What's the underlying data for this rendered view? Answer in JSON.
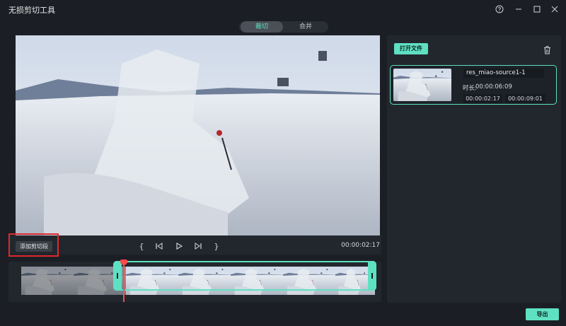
{
  "window": {
    "title": "无损剪切工具"
  },
  "tabs": [
    {
      "label": "裁切",
      "active": true
    },
    {
      "label": "合并",
      "active": false
    }
  ],
  "player": {
    "add_clip_label": "添加剪切段",
    "mark_in_symbol": "{",
    "mark_out_symbol": "}",
    "current_time": "00:00:02:17"
  },
  "files": {
    "open_file_label": "打开文件",
    "items": [
      {
        "name": "res_miao-source1-1",
        "duration_label": "时长:",
        "duration": "00:00:06:09",
        "start": "00:00:02:17",
        "end": "00:00:09:01"
      }
    ]
  },
  "export_label": "导出",
  "colors": {
    "accent": "#5ee0c2",
    "playhead": "#ff4a4a",
    "highlight": "#e0282e",
    "background": "#1b1f25",
    "panel": "#22272e"
  },
  "icons": [
    "help-icon",
    "minimize-icon",
    "maximize-icon",
    "close-icon",
    "prev-frame-icon",
    "play-icon",
    "next-frame-icon",
    "trash-icon"
  ]
}
